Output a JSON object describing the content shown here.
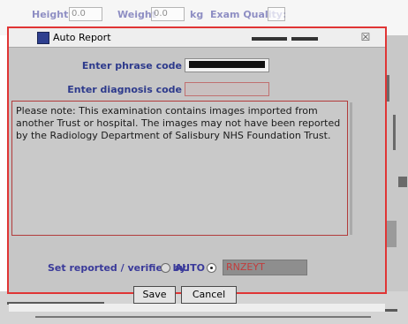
{
  "background": {
    "height_label": "Height",
    "height_value": "0.0",
    "weight_label": "Weight",
    "weight_value": "0.0",
    "unit": "kg",
    "exam_quality_label": "Exam Quality:"
  },
  "dialog": {
    "title": "Auto Report",
    "close_glyph": "☒",
    "phrase_label": "Enter phrase code",
    "diagnosis_label": "Enter diagnosis code",
    "diagnosis_value": "",
    "note_text": "Please note: This examination contains images imported from another Trust or hospital. The images may not have been reported by the Radiology Department of Salisbury NHS Foundation Trust.",
    "reported_label": "Set reported / verified by:",
    "auto_label": "AUTO",
    "selected_option": "user",
    "user_value": "RNZEYT",
    "save_label": "Save",
    "cancel_label": "Cancel"
  },
  "colors": {
    "dialog_border": "#e03535",
    "label_text": "#2d3a8c",
    "user_value_text": "#c23c3c"
  },
  "icons": {
    "title_icon": "app-window-icon",
    "close_icon": "close-icon"
  }
}
